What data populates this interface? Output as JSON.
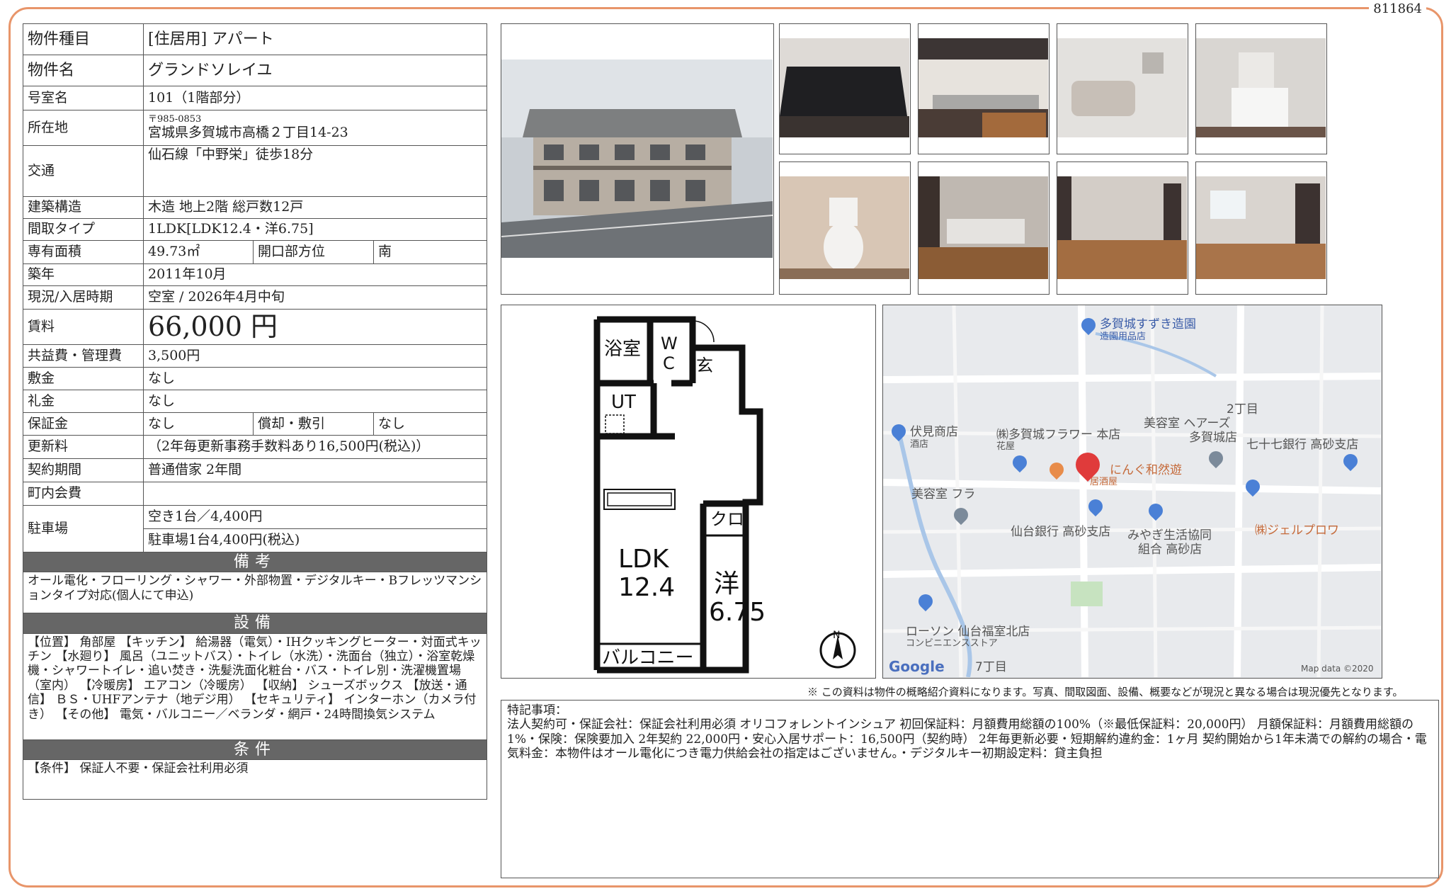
{
  "doc_id": "811864",
  "property": {
    "type_label": "物件種目",
    "type_value": "[住居用]  アパート",
    "name_label": "物件名",
    "name_value": "グランドソレイユ",
    "room_label": "号室名",
    "room_value": "101（1階部分）",
    "address_label": "所在地",
    "postal": "〒985-0853",
    "address_value": "宮城県多賀城市高橋２丁目14-23",
    "transport_label": "交通",
    "transport_value": "仙石線「中野栄」徒歩18分",
    "structure_label": "建築構造",
    "structure_value": "木造  地上2階  総戸数12戸",
    "layout_label": "間取タイプ",
    "layout_value": "1LDK[LDK12.4・洋6.75]",
    "area_label": "専有面積",
    "area_value": "49.73㎡",
    "direction_label": "開口部方位",
    "direction_value": "南",
    "built_label": "築年",
    "built_value": "2011年10月",
    "status_label": "現況/入居時期",
    "status_value": "空室  /  2026年4月中旬",
    "rent_label": "賃料",
    "rent_value": "66,000 円",
    "fee_label": "共益費・管理費",
    "fee_value": "3,500円",
    "deposit_label": "敷金",
    "deposit_value": "なし",
    "keymoney_label": "礼金",
    "keymoney_value": "なし",
    "guarantee_label": "保証金",
    "guarantee_value": "なし",
    "amort_label": "償却・敷引",
    "amort_value": "なし",
    "renewal_label": "更新料",
    "renewal_value": "（2年毎更新事務手数料あり16,500円(税込)）",
    "contract_label": "契約期間",
    "contract_value": "普通借家  2年間",
    "town_label": "町内会費",
    "town_value": "",
    "parking_label": "駐車場",
    "parking_value1": "空き1台／4,400円",
    "parking_value2": "駐車場1台4,400円(税込)"
  },
  "remarks": {
    "header": "備考",
    "text": "オール電化・フローリング・シャワー・外部物置・デジタルキー・Bフレッツマンションタイプ対応(個人にて申込)"
  },
  "equipment": {
    "header": "設備",
    "text": "【位置】 角部屋 【キッチン】 給湯器（電気）・IHクッキングヒーター・対面式キッチン 【水廻り】 風呂（ユニットバス）・トイレ（水洗）・洗面台（独立）・浴室乾燥機・シャワートイレ・追い焚き・洗髪洗面化粧台・バス・トイレ別・洗濯機置場（室内） 【冷暖房】 エアコン（冷暖房） 【収納】 シューズボックス 【放送・通信】 ＢＳ・UHFアンテナ（地デジ用） 【セキュリティ】 インターホン（カメラ付き） 【その他】 電気・バルコニー／ベランダ・網戸・24時間換気システム"
  },
  "conditions": {
    "header": "条件",
    "text": "【条件】 保証人不要・保証会社利用必須"
  },
  "floorplan": {
    "bath": "浴室",
    "wc1": "W",
    "wc2": "C",
    "entrance": "玄",
    "ut": "UT",
    "closet": "クロ",
    "ldk1": "LDK",
    "ldk2": "12.4",
    "western1": "洋",
    "western2": "6.75",
    "balcony": "バルコニー",
    "north": "N"
  },
  "map": {
    "labels": [
      "多賀城すずき造園",
      "造園用品店",
      "2丁目",
      "伏見商店",
      "酒店",
      "㈱多賀城フラワー 本店",
      "花屋",
      "美容室 ヘアーズ",
      "多賀城店",
      "七十七銀行 高砂支店",
      "にんぐ和然遊",
      "居酒屋",
      "美容室 フラ",
      "仙台銀行 高砂支店",
      "みやぎ生活協同",
      "組合 高砂店",
      "㈱ジェルプロワ",
      "ローソン 仙台福室北店",
      "コンビニエンスストア",
      "Google",
      "7丁目",
      "Map data ©2020"
    ]
  },
  "disclaimer": "※ この資料は物件の概略紹介資料になります。写真、間取図面、設備、概要などが現況と異なる場合は現況優先となります。",
  "special": {
    "title": "特記事項：",
    "text": "法人契約可・保証会社：保証会社利用必須 オリコフォレントインシュア 初回保証料：月額費用総額の100%（※最低保証料：20,000円） 月額保証料：月額費用総額の1%・保険：保険要加入 2年契約 22,000円・安心入居サポート：16,500円（契約時） 2年毎更新必要・短期解約違約金：1ヶ月 契約開始から1年未満での解約の場合・電気料金：本物件はオール電化につき電力供給会社の指定はございません。・デジタルキー初期設定料：貸主負担"
  }
}
